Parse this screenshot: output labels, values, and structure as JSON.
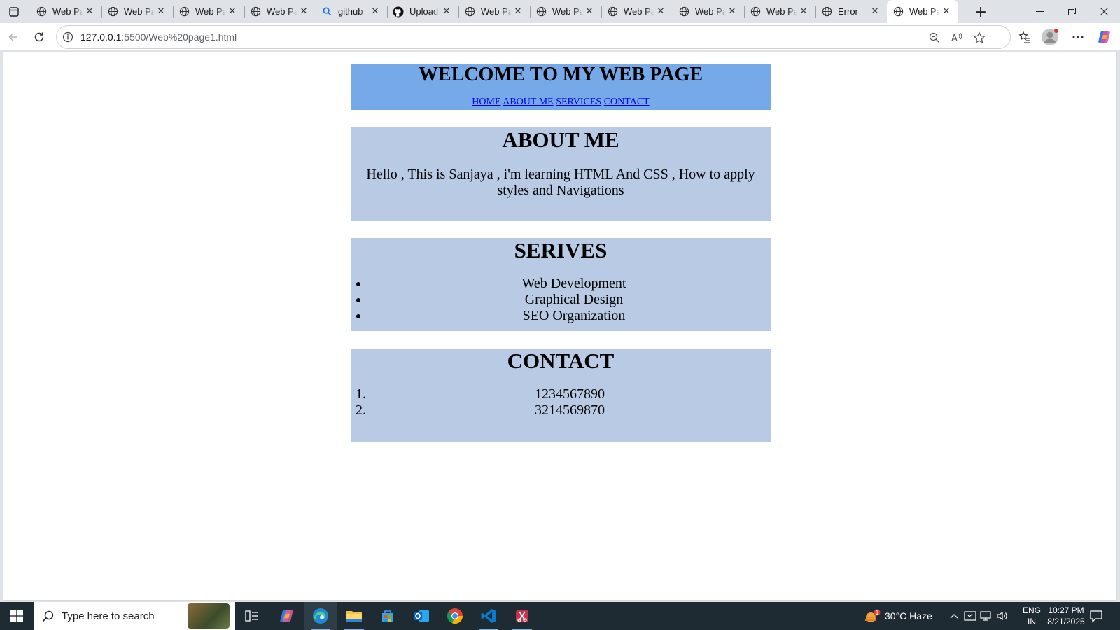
{
  "browser": {
    "tabs": [
      {
        "label": "Web Page",
        "icon": "globe-icon",
        "active": false
      },
      {
        "label": "Web Page",
        "icon": "globe-icon",
        "active": false
      },
      {
        "label": "Web Page",
        "icon": "globe-icon",
        "active": false
      },
      {
        "label": "Web Page",
        "icon": "globe-icon",
        "active": false
      },
      {
        "label": "github",
        "icon": "search-icon",
        "active": false
      },
      {
        "label": "Upload",
        "icon": "github-icon",
        "active": false
      },
      {
        "label": "Web Page",
        "icon": "globe-icon",
        "active": false
      },
      {
        "label": "Web Page",
        "icon": "globe-icon",
        "active": false
      },
      {
        "label": "Web Page",
        "icon": "globe-icon",
        "active": false
      },
      {
        "label": "Web Page",
        "icon": "globe-icon",
        "active": false
      },
      {
        "label": "Web Page",
        "icon": "globe-icon",
        "active": false
      },
      {
        "label": "Error",
        "icon": "globe-icon",
        "active": false
      },
      {
        "label": "Web Page",
        "icon": "globe-icon",
        "active": true
      }
    ],
    "url_host": "127.0.0.1",
    "url_path": ":5500/Web%20page1.html"
  },
  "page": {
    "title": "WELCOME TO MY WEB PAGE",
    "nav": [
      "HOME",
      "ABOUT ME",
      "SERVICES",
      "CONTACT"
    ],
    "about_heading": "ABOUT ME",
    "about_text": "Hello , This is Sanjaya , i'm learning HTML And CSS , How to apply styles and Navigations",
    "services_heading": "SERIVES",
    "services": [
      "Web Development",
      "Graphical Design",
      "SEO Organization"
    ],
    "contact_heading": "CONTACT",
    "contacts": [
      "1234567890",
      "3214569870"
    ]
  },
  "taskbar": {
    "search_placeholder": "Type here to search",
    "weather": "30°C  Haze",
    "weather_badge": "1",
    "lang_line1": "ENG",
    "lang_line2": "IN",
    "time": "10:27 PM",
    "date": "8/21/2025"
  },
  "colors": {
    "header_bg": "#76a9e8",
    "section_bg": "#b9cbe4",
    "link": "#0000ee",
    "taskbar": "#1f2b33"
  }
}
